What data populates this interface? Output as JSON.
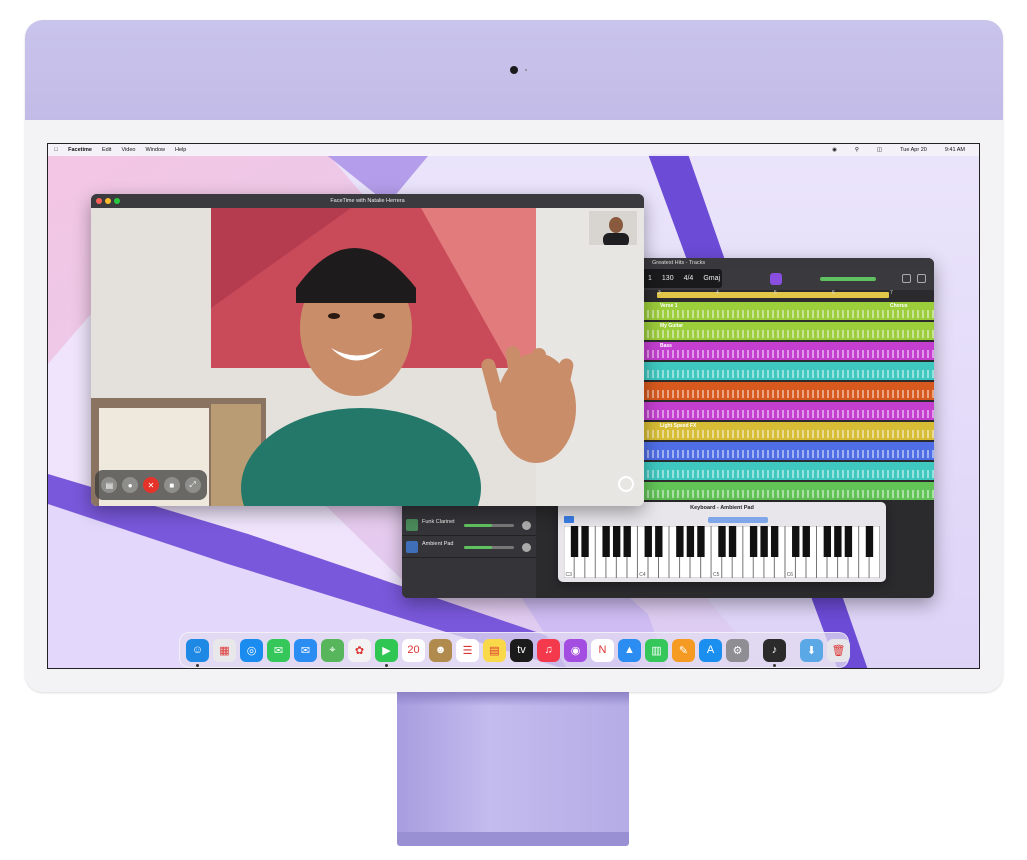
{
  "menubar": {
    "apple_icon": "apple-logo-icon",
    "app_name": "Facetime",
    "items": [
      "Edit",
      "Video",
      "Window",
      "Help"
    ],
    "status_icons": [
      "wifi-icon",
      "search-icon",
      "control-center-icon"
    ],
    "date": "Tue Apr 20",
    "time": "9:41 AM"
  },
  "facetime": {
    "title": "FaceTime with Natalie Herrera",
    "controls": [
      "sidebar-icon",
      "microphone-icon",
      "end-call-icon",
      "video-camera-icon",
      "fullscreen-icon"
    ],
    "end_call_glyph": "✕"
  },
  "garageband": {
    "title": "Greatest Hits - Tracks",
    "lcd": {
      "bar": "1",
      "tempo": "130",
      "time_sig": "4/4",
      "key": "Gmaj"
    },
    "ruler": [
      "3",
      "4",
      "5",
      "6",
      "7"
    ],
    "tracks": [
      {
        "name": "Verse 1",
        "color": "#9ccd3b",
        "end_label": "Chorus"
      },
      {
        "name": "My Guitar",
        "color": "#9ccd3b"
      },
      {
        "name": "Bass",
        "color": "#c43fd0"
      },
      {
        "name": "",
        "color": "#3ec8c0"
      },
      {
        "name": "",
        "color": "#d8591e"
      },
      {
        "name": "",
        "color": "#c43fd0"
      },
      {
        "name": "Light Speed FX",
        "color": "#d7bd35"
      },
      {
        "name": "",
        "color": "#4f6ee6"
      },
      {
        "name": "",
        "color": "#3ec8c0"
      },
      {
        "name": "",
        "color": "#62c457"
      }
    ],
    "track_headers": [
      {
        "name": "Funk Clarinet"
      },
      {
        "name": "Ambient Pad"
      }
    ],
    "keyboard": {
      "title": "Keyboard - Ambient Pad",
      "octave_labels": [
        "C3",
        "C4",
        "C5",
        "C6"
      ]
    }
  },
  "dock": {
    "apps": [
      {
        "name": "finder-icon",
        "color": "#1e88e5",
        "glyph": "☺",
        "running": true
      },
      {
        "name": "launchpad-icon",
        "color": "#e8e8ea",
        "glyph": "▦",
        "running": false
      },
      {
        "name": "safari-icon",
        "color": "#1a8cf0",
        "glyph": "◎",
        "running": false
      },
      {
        "name": "messages-icon",
        "color": "#35c75a",
        "glyph": "✉",
        "running": false
      },
      {
        "name": "mail-icon",
        "color": "#2b8cf2",
        "glyph": "✉",
        "running": false
      },
      {
        "name": "maps-icon",
        "color": "#57b65c",
        "glyph": "⌖",
        "running": false
      },
      {
        "name": "photos-icon",
        "color": "#f3f3f3",
        "glyph": "✿",
        "running": false
      },
      {
        "name": "facetime-icon",
        "color": "#2fc653",
        "glyph": "▶",
        "running": true
      },
      {
        "name": "calendar-icon",
        "color": "#ffffff",
        "glyph": "20",
        "running": false
      },
      {
        "name": "contacts-icon",
        "color": "#b18a4e",
        "glyph": "☻",
        "running": false
      },
      {
        "name": "reminders-icon",
        "color": "#ffffff",
        "glyph": "☰",
        "running": false
      },
      {
        "name": "notes-icon",
        "color": "#f9d84a",
        "glyph": "▤",
        "running": false
      },
      {
        "name": "apple-tv-icon",
        "color": "#1b1b1b",
        "glyph": "tv",
        "running": false
      },
      {
        "name": "music-icon",
        "color": "#f4394c",
        "glyph": "♫",
        "running": false
      },
      {
        "name": "podcasts-icon",
        "color": "#a34ee1",
        "glyph": "◉",
        "running": false
      },
      {
        "name": "news-icon",
        "color": "#ffffff",
        "glyph": "N",
        "running": false
      },
      {
        "name": "keynote-icon",
        "color": "#2b8cf2",
        "glyph": "▲",
        "running": false
      },
      {
        "name": "numbers-icon",
        "color": "#35c75a",
        "glyph": "▥",
        "running": false
      },
      {
        "name": "pages-icon",
        "color": "#f59b23",
        "glyph": "✎",
        "running": false
      },
      {
        "name": "app-store-icon",
        "color": "#1b8ff0",
        "glyph": "A",
        "running": false
      },
      {
        "name": "system-preferences-icon",
        "color": "#8e8e93",
        "glyph": "⚙",
        "running": false
      }
    ],
    "after_sep": [
      {
        "name": "garageband-icon",
        "color": "#2b2b2b",
        "glyph": "♪",
        "running": true
      }
    ],
    "after_sep2": [
      {
        "name": "downloads-folder-icon",
        "color": "#5aa9e6",
        "glyph": "⬇",
        "running": false
      },
      {
        "name": "trash-icon",
        "color": "#e6e6ea",
        "glyph": "🗑",
        "running": false
      }
    ]
  },
  "calendar_label": "20",
  "colors": {
    "imac_purple": "#c4bde9",
    "accent_purple": "#7a5ad8"
  }
}
